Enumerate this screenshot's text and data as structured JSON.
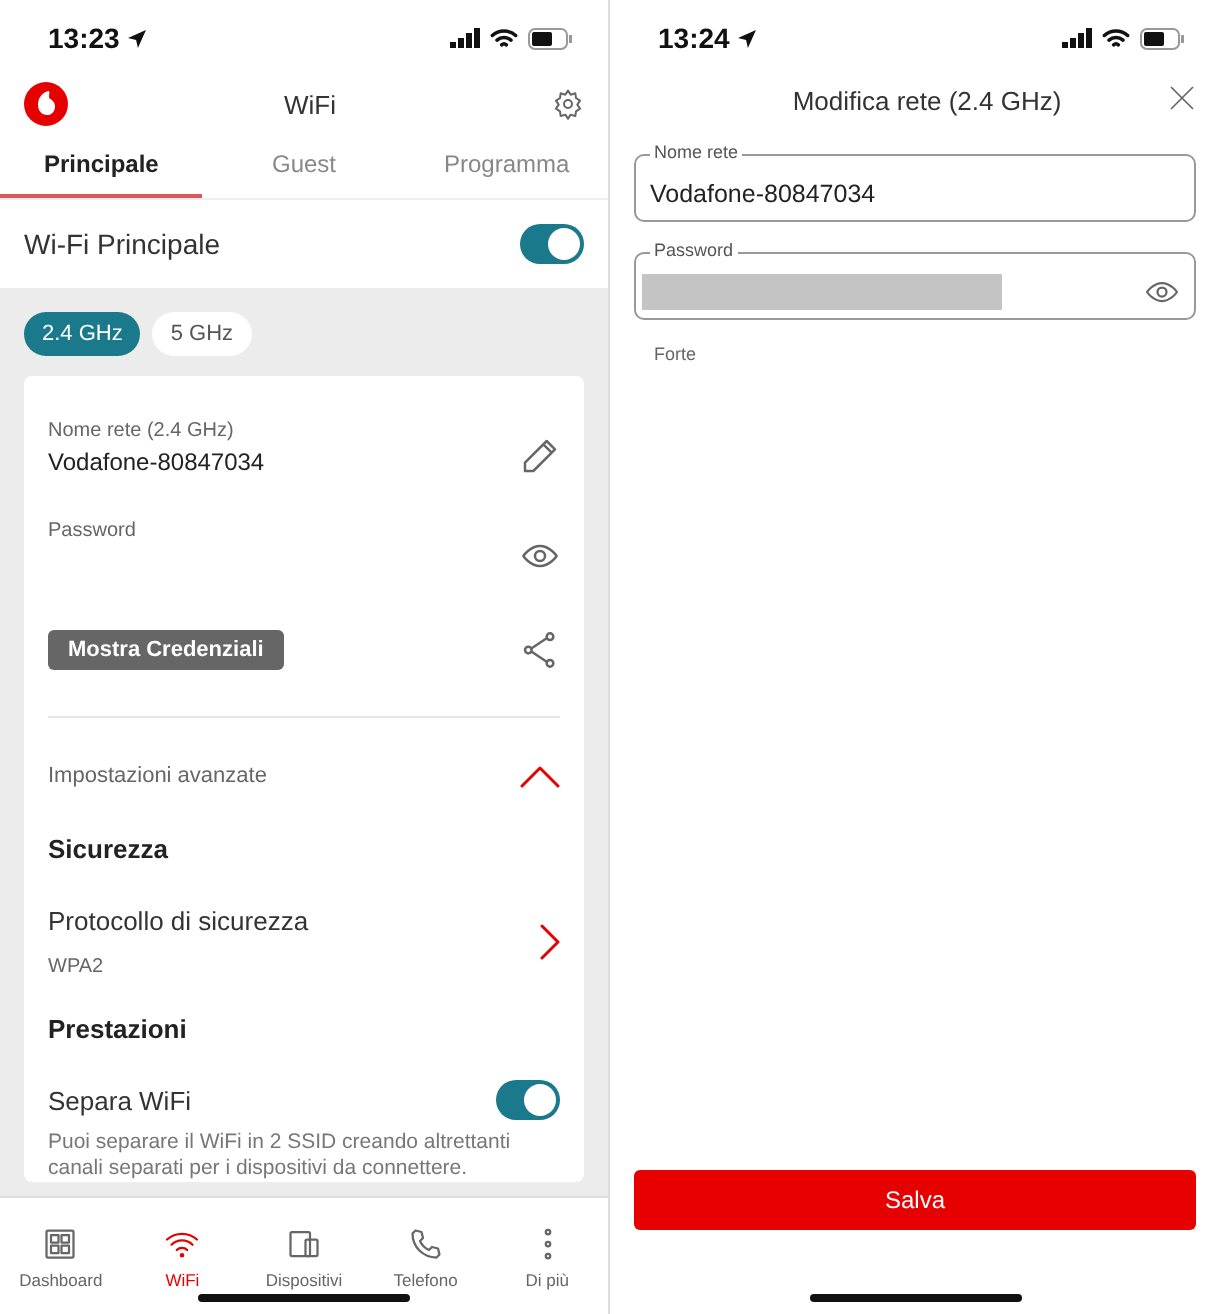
{
  "left": {
    "status_bar": {
      "time": "13:23"
    },
    "header": {
      "title": "WiFi"
    },
    "tabs": [
      {
        "label": "Principale",
        "selected": true
      },
      {
        "label": "Guest",
        "selected": false
      },
      {
        "label": "Programma",
        "selected": false
      }
    ],
    "main_wifi": {
      "label": "Wi-Fi Principale",
      "on": true
    },
    "bands": [
      {
        "label": "2.4 GHz",
        "selected": true
      },
      {
        "label": "5 GHz",
        "selected": false
      }
    ],
    "card": {
      "network_name_label": "Nome rete (2.4 GHz)",
      "network_name": "Vodafone-80847034",
      "password_label": "Password",
      "show_credentials_button": "Mostra Credenziali",
      "advanced": {
        "label": "Impostazioni avanzate",
        "expanded": true
      },
      "security_heading": "Sicurezza",
      "protocol": {
        "label": "Protocollo di sicurezza",
        "value": "WPA2"
      },
      "performance_heading": "Prestazioni",
      "split_wifi": {
        "label": "Separa WiFi",
        "on": true,
        "description": "Puoi separare il WiFi in 2 SSID creando altrettanti canali separati per i dispositivi da connettere."
      }
    },
    "bottom_nav": [
      {
        "kind": "dashboard",
        "label": "Dashboard",
        "selected": false
      },
      {
        "kind": "wifi",
        "label": "WiFi",
        "selected": true
      },
      {
        "kind": "devices",
        "label": "Dispositivi",
        "selected": false
      },
      {
        "kind": "phone",
        "label": "Telefono",
        "selected": false
      },
      {
        "kind": "more",
        "label": "Di più",
        "selected": false
      }
    ]
  },
  "right": {
    "status_bar": {
      "time": "13:24"
    },
    "title": "Modifica rete (2.4 GHz)",
    "fields": [
      {
        "kind": "text",
        "label": "Nome rete",
        "value": "Vodafone-80847034"
      },
      {
        "kind": "password",
        "label": "Password"
      }
    ],
    "strength": "Forte",
    "save_button": "Salva"
  }
}
